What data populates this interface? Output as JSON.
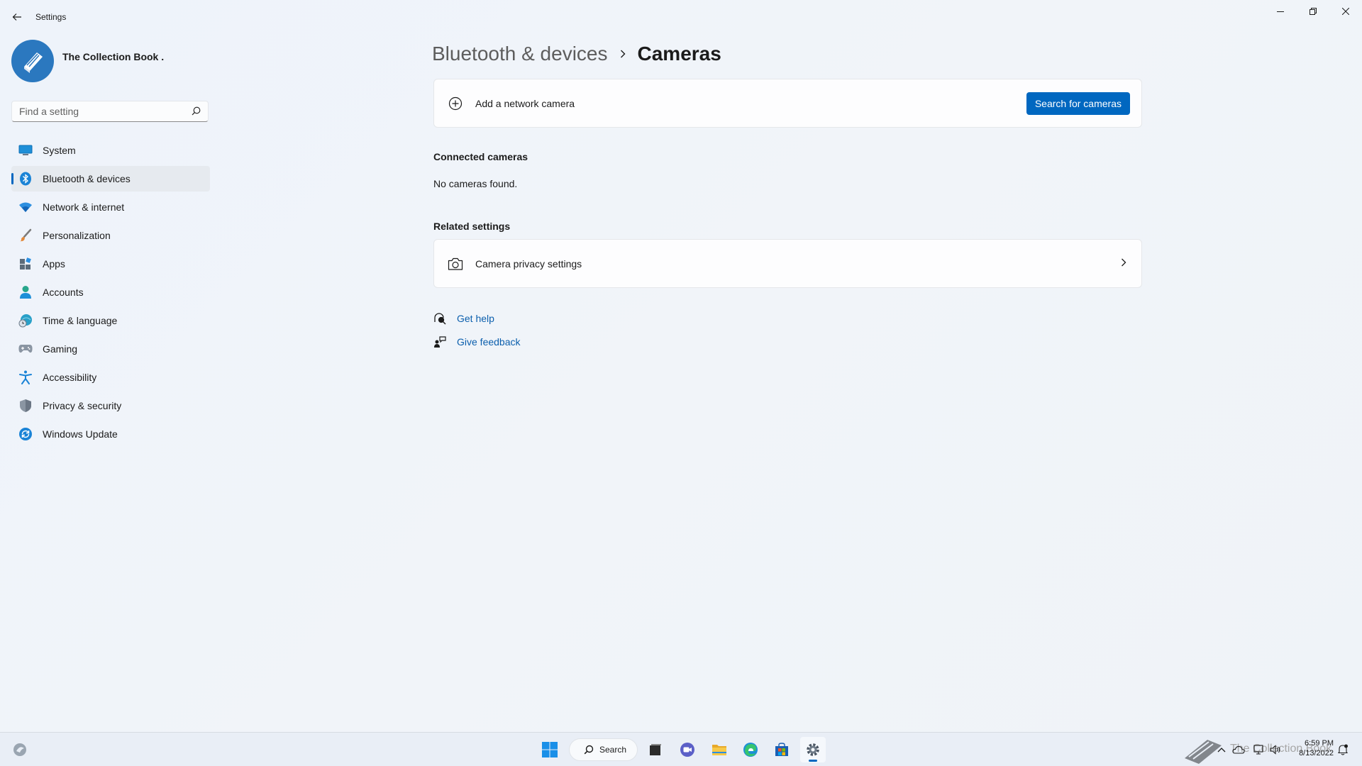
{
  "window": {
    "title": "Settings",
    "back_icon": "back-arrow-icon",
    "controls": [
      "minimize-icon",
      "restore-icon",
      "close-icon"
    ]
  },
  "profile": {
    "name": "The Collection Book .",
    "avatar_icon": "book-icon",
    "avatar_color": "#2b78bf"
  },
  "search": {
    "placeholder": "Find a setting",
    "value": "",
    "icon": "search-icon"
  },
  "sidebar": {
    "items": [
      {
        "label": "System",
        "icon": "monitor-icon",
        "active": false
      },
      {
        "label": "Bluetooth & devices",
        "icon": "bluetooth-icon",
        "active": true
      },
      {
        "label": "Network & internet",
        "icon": "wifi-icon",
        "active": false
      },
      {
        "label": "Personalization",
        "icon": "brush-icon",
        "active": false
      },
      {
        "label": "Apps",
        "icon": "apps-icon",
        "active": false
      },
      {
        "label": "Accounts",
        "icon": "person-icon",
        "active": false
      },
      {
        "label": "Time & language",
        "icon": "globe-clock-icon",
        "active": false
      },
      {
        "label": "Gaming",
        "icon": "gamepad-icon",
        "active": false
      },
      {
        "label": "Accessibility",
        "icon": "accessibility-icon",
        "active": false
      },
      {
        "label": "Privacy & security",
        "icon": "shield-icon",
        "active": false
      },
      {
        "label": "Windows Update",
        "icon": "update-icon",
        "active": false
      }
    ]
  },
  "main": {
    "breadcrumb": {
      "parent": "Bluetooth & devices",
      "current": "Cameras"
    },
    "add_camera": {
      "label": "Add a network camera",
      "icon": "add-circle-icon",
      "button_label": "Search for cameras"
    },
    "connected": {
      "title": "Connected cameras",
      "empty_text": "No cameras found."
    },
    "related": {
      "title": "Related settings",
      "privacy_label": "Camera privacy settings",
      "icon": "camera-icon"
    },
    "help_links": {
      "get_help": "Get help",
      "give_feedback": "Give feedback"
    }
  },
  "taskbar": {
    "search_label": "Search",
    "apps": [
      "widgets-icon",
      "start-icon",
      "task-view-icon",
      "chat-icon",
      "file-explorer-icon",
      "edge-icon",
      "store-icon",
      "settings-icon"
    ],
    "active_app": "settings-icon",
    "watermark_text": "The Collection Book",
    "clock": {
      "time": "6:59 PM",
      "date": "8/13/2022"
    },
    "accent": "#0067c0"
  }
}
